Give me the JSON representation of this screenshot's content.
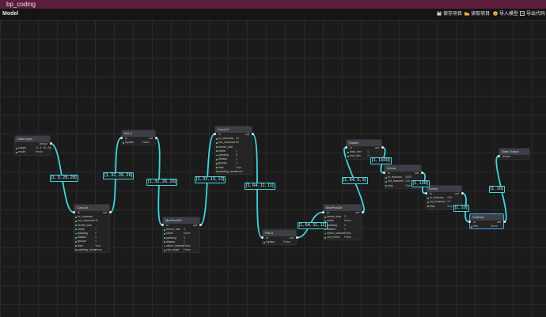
{
  "window": {
    "title": "bp_coding"
  },
  "toolbar": {
    "app_label": "Model",
    "buttons": [
      {
        "label": "保存项目",
        "icon": "save-icon"
      },
      {
        "label": "读取项目",
        "icon": "folder-icon"
      },
      {
        "label": "导入模型",
        "icon": "smile-icon"
      },
      {
        "label": "导出代码",
        "icon": "export-icon"
      }
    ]
  },
  "colors": {
    "wire": "#3fd6e0",
    "titlebar": "#5b1d3a",
    "header": "#3c3f45"
  },
  "nodes": [
    {
      "id": "data-input",
      "title": "Data Input",
      "out_label": "tensor",
      "params": [
        {
          "k": "shape",
          "v": "(1, 3, 28, 28)"
        },
        {
          "k": "mode",
          "v": "rando"
        }
      ]
    },
    {
      "id": "conv2d-1",
      "title": "Conv2d",
      "in_label": "in",
      "out_label": "out",
      "params": [
        {
          "k": "in_channels",
          "v": ""
        },
        {
          "k": "out_channels",
          "v": "32"
        },
        {
          "k": "kernel_size",
          "v": ""
        },
        {
          "k": "stride",
          "v": "1"
        },
        {
          "k": "padding",
          "v": "0"
        },
        {
          "k": "dilation",
          "v": "1"
        },
        {
          "k": "groups",
          "v": "1"
        },
        {
          "k": "bias",
          "v": "True"
        },
        {
          "k": "padding_mode",
          "v": "zeros"
        }
      ]
    },
    {
      "id": "relu-1",
      "title": "ReLU",
      "in_label": "in",
      "out_label": "out",
      "params": [
        {
          "k": "inplace",
          "v": "False"
        }
      ]
    },
    {
      "id": "maxpool-1",
      "title": "MaxPool2d",
      "in_label": "in",
      "out_label": "out",
      "params": [
        {
          "k": "kernel_size",
          "v": "2"
        },
        {
          "k": "stride",
          "v": "None"
        },
        {
          "k": "padding",
          "v": "0"
        },
        {
          "k": "dilation",
          "v": "1"
        },
        {
          "k": "return_indices",
          "v": "False"
        },
        {
          "k": "ceil_mode",
          "v": "False"
        }
      ]
    },
    {
      "id": "conv2d-2",
      "title": "Conv2d",
      "in_label": "in",
      "out_label": "out",
      "params": [
        {
          "k": "in_channels",
          "v": "32"
        },
        {
          "k": "out_channels",
          "v": "64"
        },
        {
          "k": "kernel_size",
          "v": ""
        },
        {
          "k": "stride",
          "v": "1"
        },
        {
          "k": "padding",
          "v": "0"
        },
        {
          "k": "dilation",
          "v": "1"
        },
        {
          "k": "groups",
          "v": "1"
        },
        {
          "k": "bias",
          "v": "True"
        },
        {
          "k": "padding_mode",
          "v": "zeros"
        }
      ]
    },
    {
      "id": "relu-2",
      "title": "ReLU",
      "in_label": "in",
      "out_label": "out",
      "params": [
        {
          "k": "inplace",
          "v": "False"
        }
      ]
    },
    {
      "id": "maxpool-2",
      "title": "MaxPool2d",
      "in_label": "in",
      "out_label": "out",
      "params": [
        {
          "k": "kernel_size",
          "v": "2"
        },
        {
          "k": "stride",
          "v": "None"
        },
        {
          "k": "padding",
          "v": "0"
        },
        {
          "k": "dilation",
          "v": "1"
        },
        {
          "k": "return_indices",
          "v": "False"
        },
        {
          "k": "ceil_mode",
          "v": "False"
        }
      ]
    },
    {
      "id": "flatten",
      "title": "Flatten",
      "in_label": "in",
      "out_label": "out",
      "params": [
        {
          "k": "start_dim",
          "v": "1"
        },
        {
          "k": "end_dim",
          "v": "-1"
        }
      ]
    },
    {
      "id": "linear-1",
      "title": "Linear",
      "in_label": "in",
      "out_label": "out",
      "params": [
        {
          "k": "in_features",
          "v": "1600"
        },
        {
          "k": "out_features",
          "v": "128"
        },
        {
          "k": "bias",
          "v": "True"
        }
      ]
    },
    {
      "id": "linear-2",
      "title": "Linear",
      "in_label": "in",
      "out_label": "out",
      "params": [
        {
          "k": "in_features",
          "v": "128"
        },
        {
          "k": "out_features",
          "v": "10"
        },
        {
          "k": "bias",
          "v": "True"
        }
      ]
    },
    {
      "id": "softmax",
      "title": "Softmax",
      "in_label": "in",
      "out_label": "out",
      "params": [
        {
          "k": "dim",
          "v": "None"
        }
      ]
    },
    {
      "id": "data-output",
      "title": "Data Output",
      "in_label": "tensor",
      "params": []
    }
  ],
  "edge_labels": [
    "[1, 3, 28, 28]",
    "[1, 32, 26, 26]",
    "[1, 32, 26, 26]",
    "[1, 32, 13, 13]",
    "[1, 64, 11, 11]",
    "[1, 64, 11, 11]",
    "[1, 64, 5, 5]",
    "[1, 1600]",
    "[1, 128]",
    "[1, 10]",
    "[1, 10]"
  ]
}
